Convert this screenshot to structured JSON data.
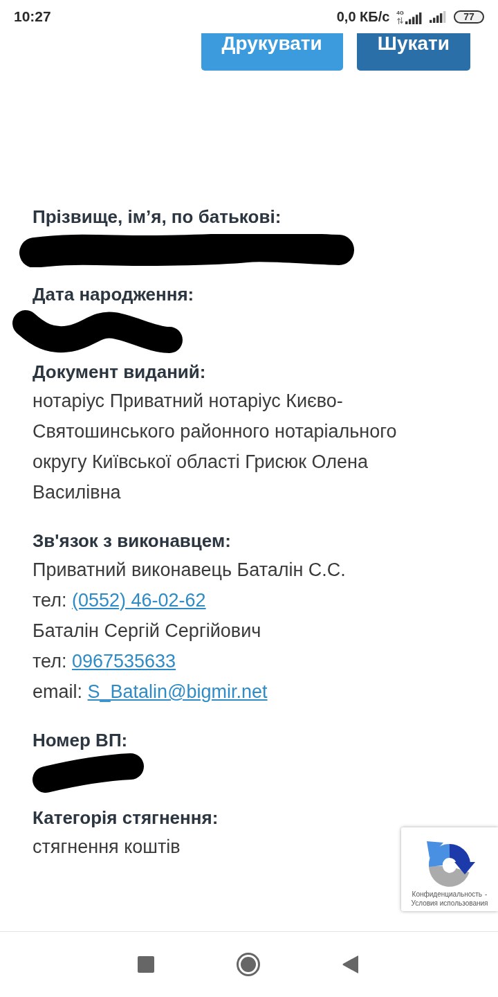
{
  "status_bar": {
    "time": "10:27",
    "network_speed": "0,0 КБ/с",
    "network_type": "4G",
    "battery": "77"
  },
  "actions": [
    {
      "label": "Друкувати",
      "kind": "secondary"
    },
    {
      "label": "Шукати",
      "kind": "primary"
    }
  ],
  "fields": [
    {
      "label": "Прізвище, ім’я, по батькові:",
      "redacted": true,
      "kind": "bar"
    },
    {
      "label": "Дата народження:",
      "redacted": true,
      "kind": "wave"
    },
    {
      "label": "Документ виданий:",
      "redacted": false,
      "kind": "text",
      "value": "нотаріус Приватний нотаріус Києво-Святошинського районного нотаріального округу Київської області Грисюк Олена Василівна"
    },
    {
      "label": "Зв'язок з виконавцем:",
      "redacted": false,
      "kind": "contacts",
      "lines": [
        {
          "text": "Приватний виконавець Баталін С.С."
        },
        {
          "text": "тел:",
          "link": "(0552) 46-02-62"
        },
        {
          "text": "Баталін Сергій Сергійович"
        },
        {
          "text": "тел:",
          "link": "0967535633"
        },
        {
          "text": "email:",
          "link": "S_Batalin@bigmir.net"
        }
      ]
    },
    {
      "label": "Номер ВП:",
      "redacted": true,
      "kind": "slant"
    },
    {
      "label": "Категорія стягнення:",
      "redacted": false,
      "kind": "text",
      "value": "стягнення коштів"
    }
  ],
  "recaptcha": {
    "privacy_link": "Конфиденциальность",
    "separator": "-",
    "terms_link": "Условия использования"
  }
}
